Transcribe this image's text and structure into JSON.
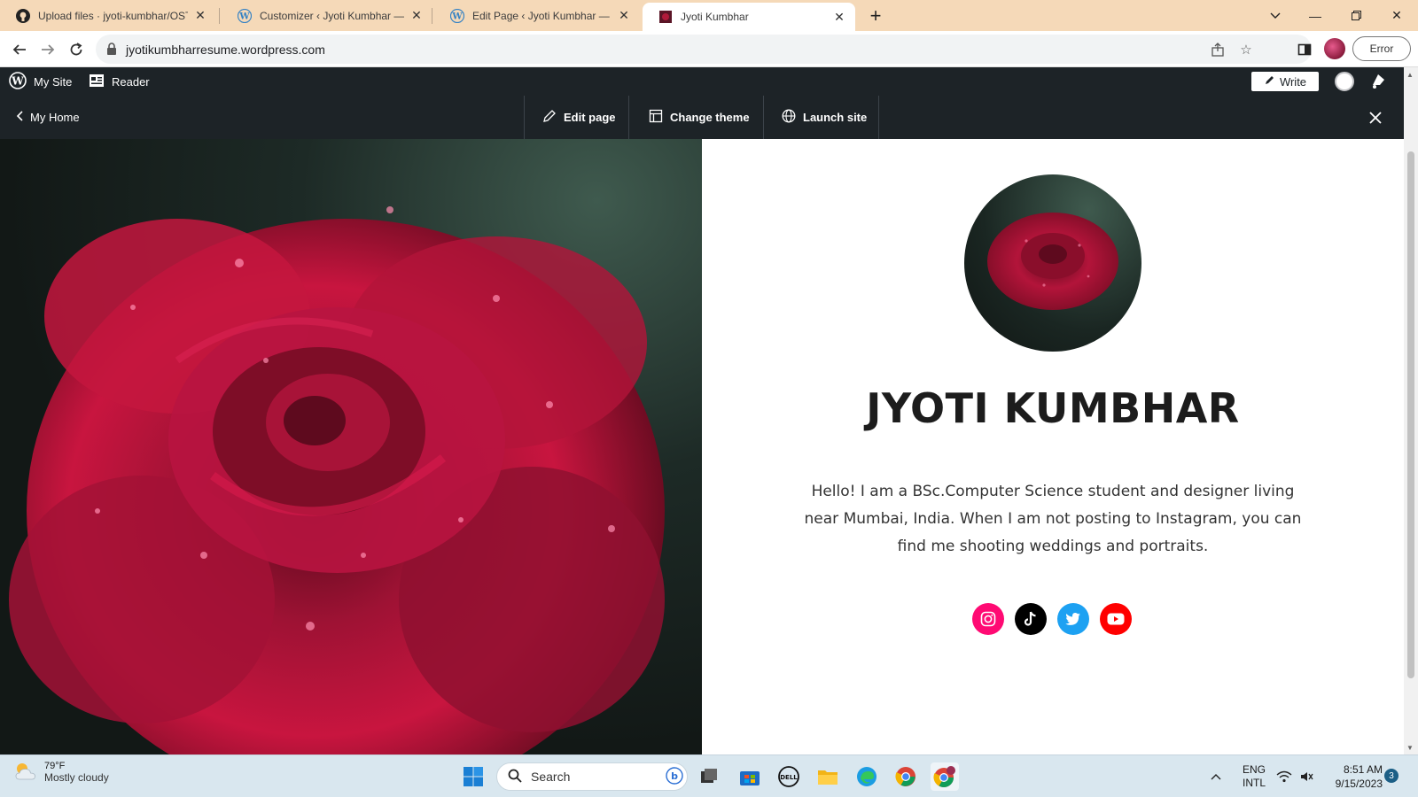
{
  "browser": {
    "tabs": [
      {
        "title": "Upload files · jyoti-kumbhar/OST",
        "icon": "github-icon",
        "active": false
      },
      {
        "title": "Customizer ‹ Jyoti Kumbhar — W",
        "icon": "wordpress-icon",
        "active": false
      },
      {
        "title": "Edit Page ‹ Jyoti Kumbhar — Wor",
        "icon": "wordpress-icon",
        "active": false
      },
      {
        "title": "Jyoti Kumbhar",
        "icon": "site-favicon",
        "active": true
      }
    ],
    "url": "jyotikumbharresume.wordpress.com",
    "profile_status": "Error"
  },
  "admin_bar": {
    "my_site": "My Site",
    "reader": "Reader",
    "write": "Write"
  },
  "preview_bar": {
    "back": "My Home",
    "edit_page": "Edit page",
    "change_theme": "Change theme",
    "launch_site": "Launch site"
  },
  "site": {
    "title": "JYOTI KUMBHAR",
    "bio": "Hello! I am a BSc.Computer Science student and designer living near Mumbai, India. When I am not posting to Instagram, you can find me shooting weddings and portraits.",
    "socials": [
      {
        "name": "instagram",
        "color": "#ff0a73"
      },
      {
        "name": "tiktok",
        "color": "#000000"
      },
      {
        "name": "twitter",
        "color": "#1da1f2"
      },
      {
        "name": "youtube",
        "color": "#ff0000"
      }
    ]
  },
  "taskbar": {
    "temperature": "79°F",
    "weather": "Mostly cloudy",
    "search_placeholder": "Search",
    "language": "ENG",
    "layout": "INTL",
    "time": "8:51 AM",
    "date": "9/15/2023",
    "notifications": "3"
  }
}
